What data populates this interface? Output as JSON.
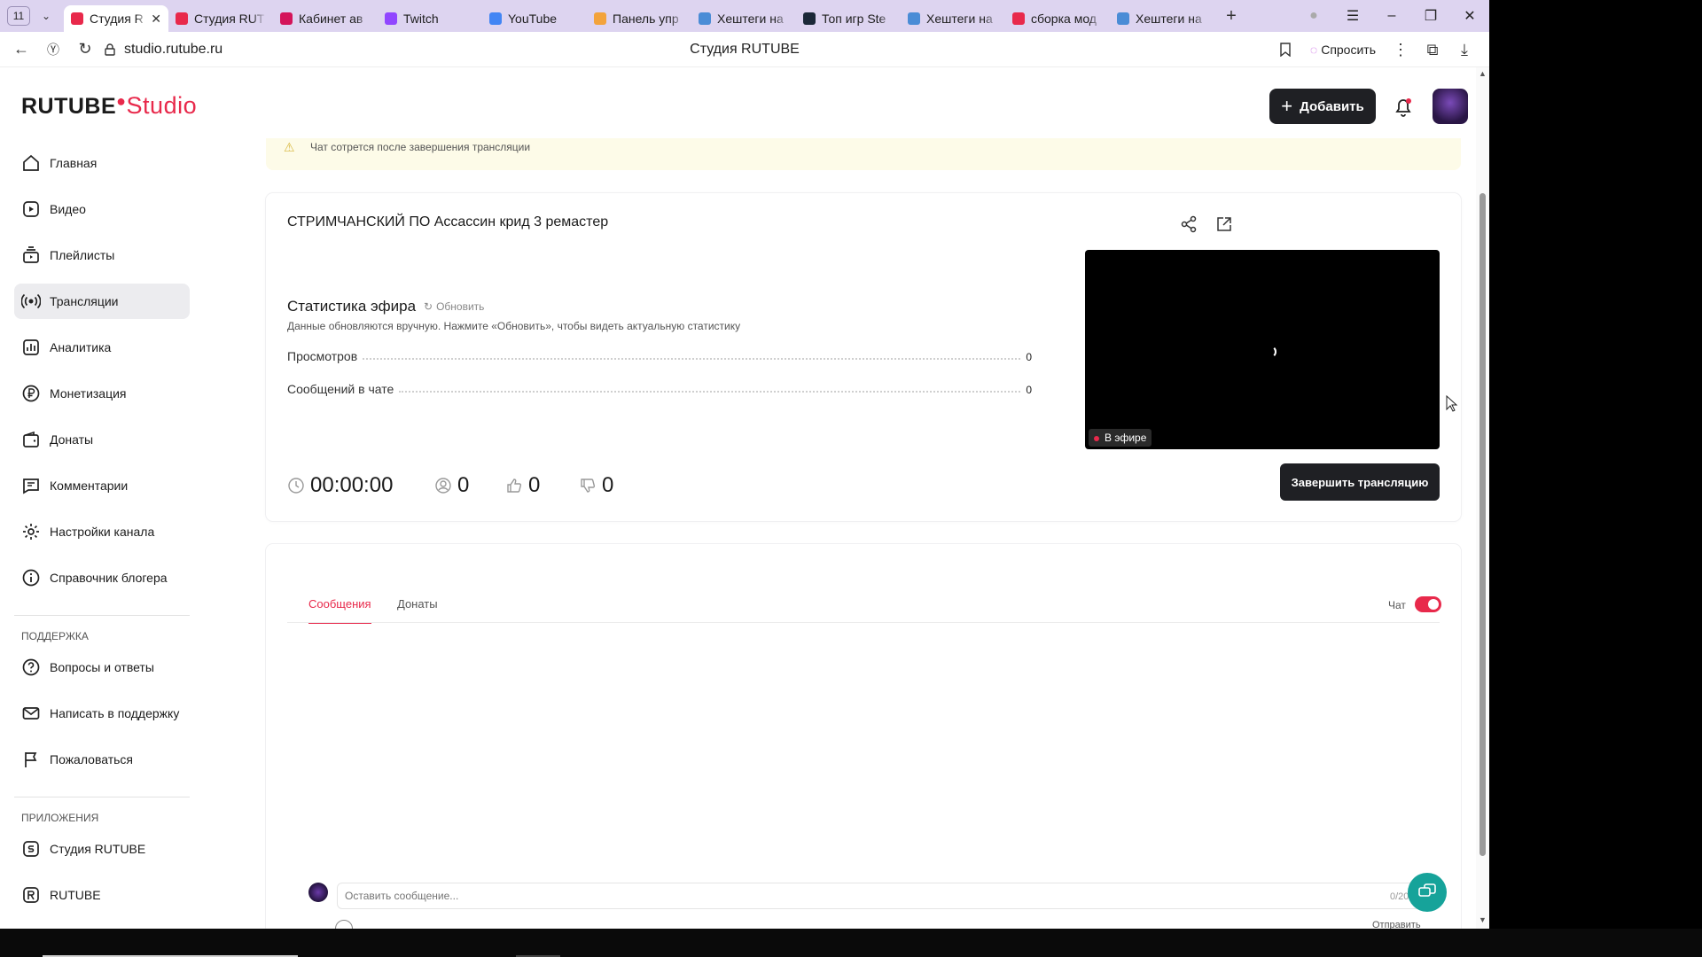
{
  "browser": {
    "tab_count": "11",
    "tabs": [
      {
        "label": "Студия R",
        "color": "#e8294b",
        "active": true
      },
      {
        "label": "Студия RUT",
        "color": "#e8294b",
        "active": false
      },
      {
        "label": "Кабинет ав",
        "color": "#d4145a",
        "active": false
      },
      {
        "label": "Twitch",
        "color": "#9146ff",
        "active": false
      },
      {
        "label": "YouTube",
        "color": "#4285f4",
        "active": false
      },
      {
        "label": "Панель упр",
        "color": "#f3a33b",
        "active": false
      },
      {
        "label": "Хештеги на",
        "color": "#4a8cd6",
        "active": false
      },
      {
        "label": "Топ игр Ste",
        "color": "#1b2838",
        "active": false
      },
      {
        "label": "Хештеги на",
        "color": "#4a8cd6",
        "active": false
      },
      {
        "label": "сборка мод",
        "color": "#e8294b",
        "active": false
      },
      {
        "label": "Хештеги на",
        "color": "#4a8cd6",
        "active": false
      }
    ],
    "url": "studio.rutube.ru",
    "page_title": "Студия RUTUBE",
    "ask_label": "Спросить"
  },
  "header": {
    "logo_main": "RUTUBE",
    "logo_studio": "Studio",
    "add_label": "Добавить"
  },
  "sidebar": {
    "items": [
      {
        "label": "Главная",
        "icon": "home-icon"
      },
      {
        "label": "Видео",
        "icon": "video-icon"
      },
      {
        "label": "Плейлисты",
        "icon": "playlist-icon"
      },
      {
        "label": "Трансляции",
        "icon": "broadcast-icon",
        "active": true
      },
      {
        "label": "Аналитика",
        "icon": "analytics-icon"
      },
      {
        "label": "Монетизация",
        "icon": "ruble-icon"
      },
      {
        "label": "Донаты",
        "icon": "wallet-icon"
      },
      {
        "label": "Комментарии",
        "icon": "comment-icon"
      },
      {
        "label": "Настройки канала",
        "icon": "gear-icon"
      },
      {
        "label": "Справочник блогера",
        "icon": "info-icon"
      }
    ],
    "support_heading": "ПОДДЕРЖКА",
    "support_items": [
      {
        "label": "Вопросы и ответы",
        "icon": "question-icon"
      },
      {
        "label": "Написать в поддержку",
        "icon": "mail-icon"
      },
      {
        "label": "Пожаловаться",
        "icon": "flag-icon"
      }
    ],
    "apps_heading": "ПРИЛОЖЕНИЯ",
    "apps_items": [
      {
        "label": "Студия RUTUBE",
        "icon": "studio-app-icon"
      },
      {
        "label": "RUTUBE",
        "icon": "rutube-app-icon"
      }
    ]
  },
  "banner": {
    "text": "Чат сотрется после завершения трансляции"
  },
  "stream": {
    "title": "СТРИМЧАНСКИЙ ПО Ассассин крид 3 ремастер",
    "stats_title": "Статистика эфира",
    "refresh_label": "Обновить",
    "stats_note": "Данные обновляются вручную. Нажмите «Обновить», чтобы видеть актуальную статистику",
    "stats": [
      {
        "label": "Просмотров",
        "value": "0"
      },
      {
        "label": "Сообщений в чате",
        "value": "0"
      }
    ],
    "live_label": "В эфире",
    "duration": "00:00:00",
    "viewers": "0",
    "likes": "0",
    "dislikes": "0",
    "end_label": "Завершить трансляцию"
  },
  "chat": {
    "tabs": [
      "Сообщения",
      "Донаты"
    ],
    "toggle_label": "Чат",
    "input_placeholder": "Оставить сообщение...",
    "counter": "0/20",
    "send_label": "Отправить"
  },
  "colors": {
    "accent": "#e8294b",
    "dark_button": "#1f2024",
    "fab": "#16a39a"
  }
}
